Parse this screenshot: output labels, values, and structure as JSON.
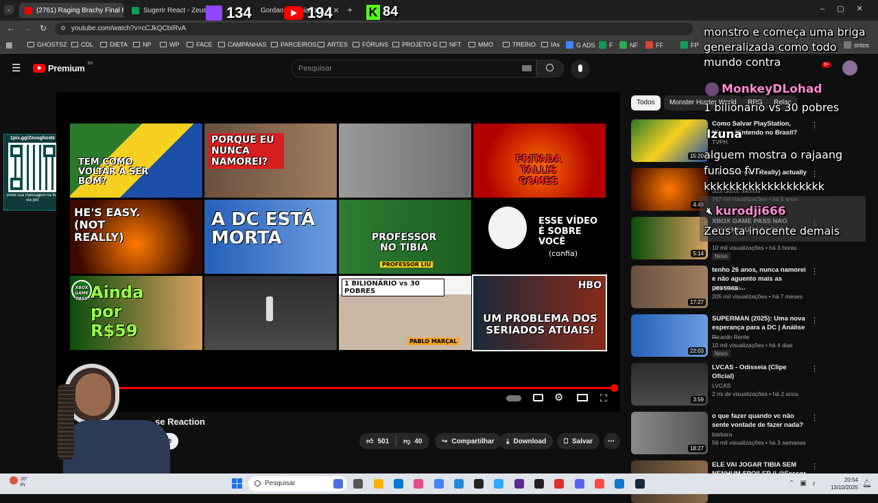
{
  "tabs": [
    {
      "label": "(2761) Raging Brachy Final Pha",
      "active": true
    },
    {
      "label": "Sugerir React - Zeus Ghostz"
    },
    {
      "label": "Gordao Ucraniano X..."
    }
  ],
  "overlay_counts": {
    "twitch": "134",
    "youtube": "194",
    "kick": "84"
  },
  "address": "youtube.com/watch?v=cCJkQCbIRvA",
  "bookmarks": [
    "GHOSTSZ",
    "CDL",
    "DIETA",
    "NP",
    "WP",
    "FACE",
    "CAMPANHAS",
    "PARCEIROS",
    "ARTES",
    "FÓRUNS",
    "PROJETO G",
    "NFT",
    "MMO",
    "TREINO",
    "IAs",
    "G ADS",
    "F",
    "NF",
    "FF",
    "FP",
    "oritos"
  ],
  "yt": {
    "logo": "Premium",
    "logo_sup": "BR",
    "search_placeholder": "Pesquisar",
    "notif_count": "9+"
  },
  "qr": {
    "url": "1pix.gg/Zeusghostz",
    "caption": "envie sua mensagem na live via pix!"
  },
  "endscreen": [
    {
      "text": "TEM COMO VOLTAR A SER BOM?"
    },
    {
      "text": "PORQUE EU NUNCA NAMOREI?"
    },
    {
      "text": ""
    },
    {
      "text": "FRITADA TALLIS GOMES"
    },
    {
      "text": "HE'S EASY. (NOT REALLY)"
    },
    {
      "text": "A DC ESTÁ MORTA"
    },
    {
      "text": "PROFESSOR NO TIBIA",
      "sub": "PROFESSOR LIU"
    },
    {
      "text": "ESSE VÍDEO É SOBRE VOCÊ",
      "sub": "(confia)"
    },
    {
      "text": "Ainda por R$59",
      "badge": "XBOX GAME PASS"
    },
    {
      "text": ""
    },
    {
      "text": "1 BILIONÁRIO vs 30 POBRES",
      "sub": "PABLO MARÇAL"
    },
    {
      "text": "UM PROBLEMA DOS SERIADOS ATUAIS!",
      "badge": "HBO"
    }
  ],
  "progress": 1.0,
  "video": {
    "title_partial": "se Reaction",
    "subscribe_partial": "r-se",
    "likes": "501",
    "dislikes": "40",
    "share": "Compartilhar",
    "download": "Download",
    "save": "Salvar"
  },
  "chips": [
    "Todos",
    "Monster Hunter World",
    "RPG",
    "Relac"
  ],
  "recs": [
    {
      "title": "Como Salvar PlayStation, Xbox e Nintendo no Brasil?",
      "channel": "TVPH",
      "views": "",
      "age": "",
      "duration": "15:20"
    },
    {
      "title": "He's Easy (Not Really) actually",
      "channel": "Just Some Memes",
      "views": "767 mil visualizações",
      "age": "há 5 anos",
      "duration": "4:49"
    },
    {
      "title": "XBOX GAME PASS NAO AUMENTOU PARA TODO",
      "channel": "",
      "views": "10 mil visualizações",
      "age": "há 3 horas",
      "duration": "5:14",
      "new": "Novo"
    },
    {
      "title": "tenho 26 anos, nunca namorei e não aguento mais as pessoas ...",
      "channel": "Luis Sellari",
      "views": "205 mil visualizações",
      "age": "há 7 meses",
      "duration": "17:27"
    },
    {
      "title": "SUPERMAN (2025): Uma nova esperança para a DC | Análise ...",
      "channel": "Ricardo Rente",
      "views": "10 mil visualizações",
      "age": "há 4 dias",
      "duration": "22:03",
      "new": "Novo"
    },
    {
      "title": "LVCAS - Odisseia (Clipe Oficial)",
      "channel": "LVCAS",
      "views": "2 mi de visualizações",
      "age": "há 2 anos",
      "duration": "3:59"
    },
    {
      "title": "o que fazer quando vc não sente vontade de fazer nada?",
      "channel": "bárbara",
      "views": "56 mil visualizações",
      "age": "há 3 semanas",
      "duration": "18:27"
    },
    {
      "title": "ELE VAI JOGAR TIBIA SEM NENHUM SPOILER || @Fessor ...",
      "channel": "",
      "views": "",
      "age": "",
      "duration": ""
    }
  ],
  "chat": [
    {
      "user": "",
      "text": "monstro e começa uma briga generalizada como todo mundo contra"
    },
    {
      "user": "MonkeyDLohad",
      "text": "1 bilionario vs 30 pobres"
    },
    {
      "user": "Izuna",
      "text": "alguem mostra o rajaang furioso fvr kkkkkkkkkkkkkkkkkkk"
    },
    {
      "user": "kurodji666",
      "text": "Zeus ta inocente demais"
    }
  ],
  "taskbar": {
    "search": "Pesquisar",
    "time": "20:54",
    "date": "13/10/2025",
    "weather": "20°",
    "weather_sub": "Pr"
  },
  "colors": {
    "yt_red": "#ff0000",
    "kick": "#53fc18",
    "twitch": "#9146ff",
    "chat_user": "#ff8bd5"
  }
}
